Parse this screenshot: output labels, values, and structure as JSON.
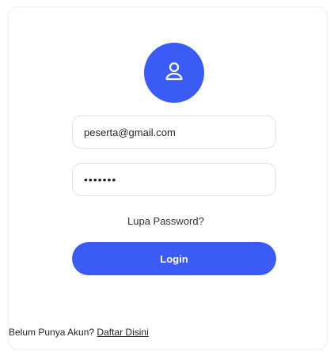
{
  "login_form": {
    "email_value": "peserta@gmail.com",
    "password_value": "•••••••",
    "forgot_password_label": "Lupa Password?",
    "login_button_label": "Login"
  },
  "footer": {
    "prompt_text": "Belum Punya Akun?",
    "register_link_label": "Daftar Disini"
  },
  "theme": {
    "accent_color": "#3b5bf5",
    "avatar_icon": "user-icon"
  }
}
